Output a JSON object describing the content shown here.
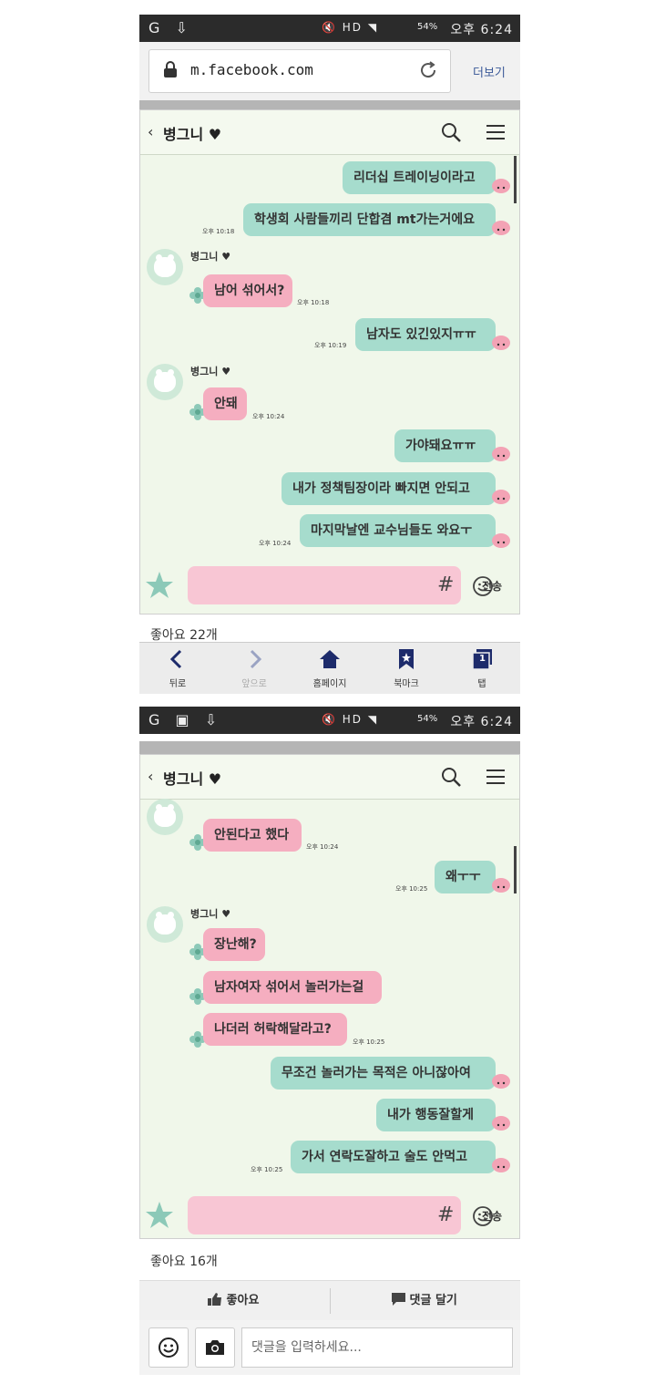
{
  "status_bar": {
    "left_icons": "G ⇩",
    "hd": "HD",
    "battery": "54%",
    "time": "오후 6:24"
  },
  "browser": {
    "url": "m.facebook.com",
    "more_label": "더보기"
  },
  "chat": {
    "title": "병그니",
    "sender": "병그니",
    "input_hash": "#",
    "send_label": "전송"
  },
  "screen1": {
    "messages": {
      "r1": "리더십 트레이닝이라고",
      "r2": "학생회 사람들끼리 단합겸 mt가는거에요",
      "r2_time": "오후 10:18",
      "l1": "남어 섞어서?",
      "l1_time": "오후 10:18",
      "r3": "남자도 있긴있지ㅠㅠ",
      "r3_time": "오후 10:19",
      "l2": "안돼",
      "l2_time": "오후 10:24",
      "r4": "가야돼요ㅠㅠ",
      "r5": "내가 정책팀장이라 빠지면 안되고",
      "r6": "마지막날엔 교수님들도 와요ㅜ",
      "r6_time": "오후 10:24"
    },
    "likes": "좋아요 22개"
  },
  "bottom_nav": {
    "back": "뒤로",
    "forward": "앞으로",
    "home": "홈페이지",
    "bookmark": "북마크",
    "tabs": "탭",
    "tab_count": "1"
  },
  "screen2": {
    "messages": {
      "l1": "안된다고 했다",
      "l1_time": "오후 10:24",
      "r1": "왜ㅜㅜ",
      "r1_time": "오후 10:25",
      "l2": "장난해?",
      "l3": "남자여자 섞어서 놀러가는걸",
      "l4": "나더러 허락해달라고?",
      "l4_time": "오후 10:25",
      "r2": "무조건 놀러가는 목적은 아니잖아여",
      "r3": "내가 행동잘할게",
      "r4": "가서 연락도잘하고 술도 안먹고",
      "r4_time": "오후 10:25"
    },
    "likes": "좋아요 16개"
  },
  "post_actions": {
    "like": "좋아요",
    "comment": "댓글 달기",
    "comment_placeholder": "댓글을 입력하세요..."
  }
}
